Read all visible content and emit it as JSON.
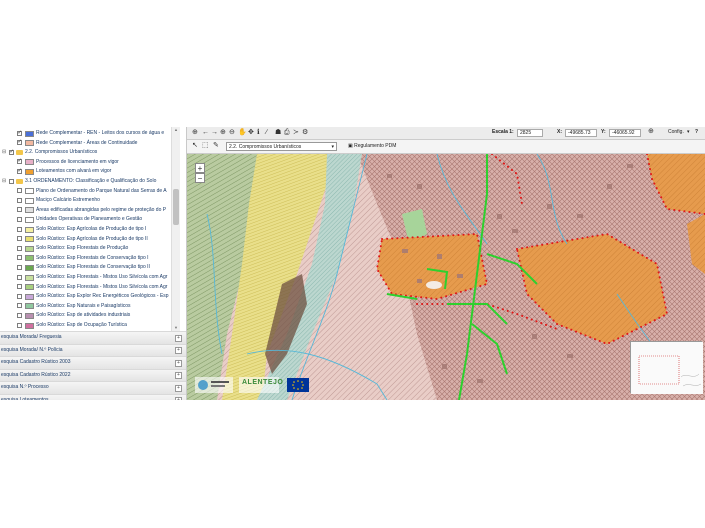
{
  "tree": {
    "items": [
      {
        "label": "Rede Complementar - REN - Leitos dos cursos de água e",
        "checked": true,
        "color": "#4a6fd8",
        "indent": 1
      },
      {
        "label": "Rede Complementar - Áreas de Continuidade",
        "checked": true,
        "color": "#f2b8a0",
        "indent": 1
      },
      {
        "label": "2.2. Compromissos Urbanísticos",
        "checked": true,
        "folder": true,
        "indent": 0
      },
      {
        "label": "Processos de licenciamento em vigor",
        "checked": true,
        "color": "#e8b0c8",
        "indent": 1
      },
      {
        "label": "Loteamentos com alvará em vigor",
        "checked": true,
        "color": "#f0a030",
        "indent": 1
      },
      {
        "label": "3.1 ORDENAMENTO: Classificação e Qualificação do Solo",
        "checked": false,
        "folder": true,
        "indent": 0
      },
      {
        "label": "Plano de Ordenamento do Parque Natural das Serras de A",
        "checked": false,
        "color": "#ffffff",
        "indent": 1
      },
      {
        "label": "Maciço Calcário Estremenho",
        "checked": false,
        "color": "#ffffff",
        "indent": 1
      },
      {
        "label": "Áreas edificadas abrangidas pelo regime de proteção do P",
        "checked": false,
        "color": "#e0e0e0",
        "indent": 1
      },
      {
        "label": "Unidades Operativas de Planeamento e Gestão",
        "checked": false,
        "color": "#ffffff",
        "indent": 1
      },
      {
        "label": "Solo Rústico: Esp Agrícolas de Produção de tipo I",
        "checked": false,
        "color": "#f5f0a0",
        "indent": 1
      },
      {
        "label": "Solo Rústico: Esp Agrícolas de Produção de tipo II",
        "checked": false,
        "color": "#e8e070",
        "indent": 1
      },
      {
        "label": "Solo Rústico: Esp Florestais de Produção",
        "checked": false,
        "color": "#b8d890",
        "indent": 1
      },
      {
        "label": "Solo Rústico: Esp Florestais de Conservação tipo I",
        "checked": false,
        "color": "#8cc070",
        "indent": 1
      },
      {
        "label": "Solo Rústico: Esp Florestais de Conservação tipo II",
        "checked": false,
        "color": "#6aa850",
        "indent": 1
      },
      {
        "label": "Solo Rústico: Esp Florestais - Mistos Uso Silvícola com Agr",
        "checked": false,
        "color": "#c8e0a0",
        "indent": 1
      },
      {
        "label": "Solo Rústico: Esp Florestais - Mistos Uso Silvícola com Agr",
        "checked": false,
        "color": "#a8d080",
        "indent": 1
      },
      {
        "label": "Solo Rústico: Esp Explor Rec Energéticos Geológicos - Esp",
        "checked": false,
        "color": "#c8a8d8",
        "indent": 1
      },
      {
        "label": "Solo Rústico: Esp Naturais e Paisagísticos",
        "checked": false,
        "color": "#90c8a0",
        "indent": 1
      },
      {
        "label": "Solo Rústico: Esp de atividades industriais",
        "checked": false,
        "color": "#b890b0",
        "indent": 1
      },
      {
        "label": "Solo Rústico: Esp de Ocupação Turística",
        "checked": false,
        "color": "#d070a0",
        "indent": 1
      }
    ]
  },
  "accordion": [
    {
      "label": "esquisa Morada/ Freguesia"
    },
    {
      "label": "esquisa Morada/ N.º Polícia"
    },
    {
      "label": "esquisa Cadastro Rústico 2003"
    },
    {
      "label": "esquisa Cadastro Rústico 2022"
    },
    {
      "label": "esquisa N.º Processo"
    },
    {
      "label": "esquisa Loteamentos"
    }
  ],
  "toolbar": {
    "scale_label": "Escala 1:",
    "scale_value": "2825",
    "x_label": "X:",
    "x_value": "-49685.73",
    "y_label": "Y:",
    "y_value": "-46065.92",
    "config_label": "Config.",
    "help_label": "?",
    "active_layer": "2.2. Compromissos Urbanísticos",
    "regulamento_label": "Regulamento PDM"
  },
  "map": {
    "zoom_in": "+",
    "zoom_out": "−",
    "logo_text": "ALENTEJO"
  }
}
